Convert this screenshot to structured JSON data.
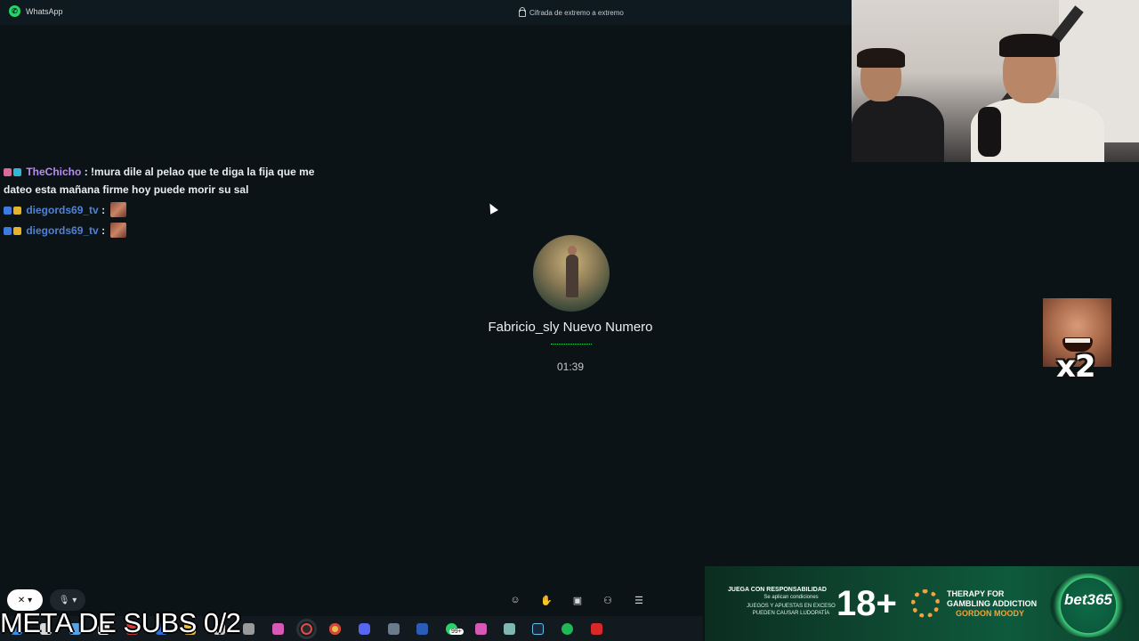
{
  "titlebar": {
    "app_name": "WhatsApp",
    "encryption": "Cifrada de extremo a extremo"
  },
  "chat": {
    "messages": [
      {
        "user": "TheChicho",
        "sep": ":",
        "text": "!mura dile al pelao que te diga la fija que me dateo esta mañana firme hoy puede morir su sal"
      },
      {
        "user": "diegords69_tv",
        "sep": ":"
      },
      {
        "user": "diegords69_tv",
        "sep": ":"
      }
    ]
  },
  "call": {
    "caller_name": "Fabricio_sly Nuevo Numero",
    "duration": "01:39"
  },
  "overlay": {
    "meme_count": "x2",
    "meta_text": "META DE SUBS 0/2"
  },
  "ad": {
    "line1": "JUEGA CON RESPONSABILIDAD",
    "line2": "Se aplican condiciones",
    "line3a": "JUEGOS Y APUESTAS EN EXCESO",
    "line3b": "PUEDEN CAUSAR LUDOPATÍA",
    "age": "18+",
    "therapy1": "THERAPY FOR",
    "therapy2": "GAMBLING ADDICTION",
    "therapy3": "GORDON MOODY",
    "brand": "bet365"
  },
  "taskbar": {
    "whatsapp_badge": "99+"
  },
  "colors": {
    "background": "#0c1317",
    "accent": "#25d366",
    "username_purple": "#b98df0",
    "username_blue": "#4f82d4"
  }
}
